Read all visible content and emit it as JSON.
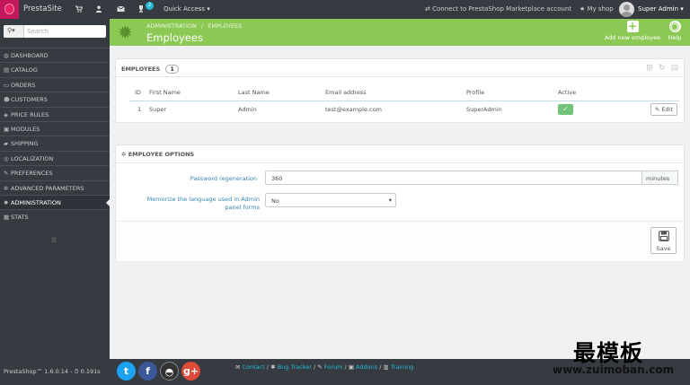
{
  "topbar": {
    "brand": "PrestaSite",
    "notification_count": "2",
    "quick_access": "Quick Access",
    "marketplace": "Connect to PrestaShop Marketplace account",
    "my_shop": "My shop",
    "user": "Super Admin"
  },
  "sidebar": {
    "search_placeholder": "Search",
    "items": [
      {
        "icon": "dashboard-icon",
        "label": "DASHBOARD"
      },
      {
        "icon": "catalog-icon",
        "label": "CATALOG"
      },
      {
        "icon": "orders-icon",
        "label": "ORDERS"
      },
      {
        "icon": "customers-icon",
        "label": "CUSTOMERS"
      },
      {
        "icon": "tag-icon",
        "label": "PRICE RULES"
      },
      {
        "icon": "puzzle-icon",
        "label": "MODULES"
      },
      {
        "icon": "truck-icon",
        "label": "SHIPPING"
      },
      {
        "icon": "globe-icon",
        "label": "LOCALIZATION"
      },
      {
        "icon": "wrench-icon",
        "label": "PREFERENCES"
      },
      {
        "icon": "cogs-icon",
        "label": "ADVANCED PARAMETERS"
      },
      {
        "icon": "gear-icon",
        "label": "ADMINISTRATION"
      },
      {
        "icon": "stats-icon",
        "label": "STATS"
      }
    ],
    "active_index": 10
  },
  "header": {
    "breadcrumb_parent": "ADMINISTRATION",
    "breadcrumb_child": "EMPLOYEES",
    "title": "Employees",
    "add_button": "Add new employee",
    "help_button": "Help"
  },
  "employees_panel": {
    "title": "EMPLOYEES",
    "count": "1",
    "columns": [
      "ID",
      "First Name",
      "Last Name",
      "Email address",
      "Profile",
      "Active",
      ""
    ],
    "rows": [
      {
        "id": "1",
        "first_name": "Super",
        "last_name": "Admin",
        "email": "test@example.com",
        "profile": "SuperAdmin",
        "active": true,
        "action": "Edit"
      }
    ]
  },
  "options_panel": {
    "title": "EMPLOYEE OPTIONS",
    "password_label": "Password regeneration",
    "password_value": "360",
    "password_unit": "minutes",
    "language_label": "Memorize the language used in Admin panel forms",
    "language_value": "No",
    "save_button": "Save"
  },
  "footer": {
    "version": "PrestaShop™ 1.6.0.14 - ⏱ 0.191s",
    "social": [
      "twitter-icon",
      "facebook-icon",
      "github-icon",
      "google-plus-icon"
    ],
    "links": [
      "Contact",
      "Bug Tracker",
      "Forum",
      "Addons",
      "Training"
    ]
  },
  "watermark": {
    "chinese": "最模板",
    "site": "www.zuimoban.com"
  },
  "colors": {
    "header_green": "#8bc954",
    "sidebar_dark": "#363a41",
    "link_blue": "#25b9d7",
    "active_green": "#72c279",
    "brand_pink": "#c2185b"
  }
}
